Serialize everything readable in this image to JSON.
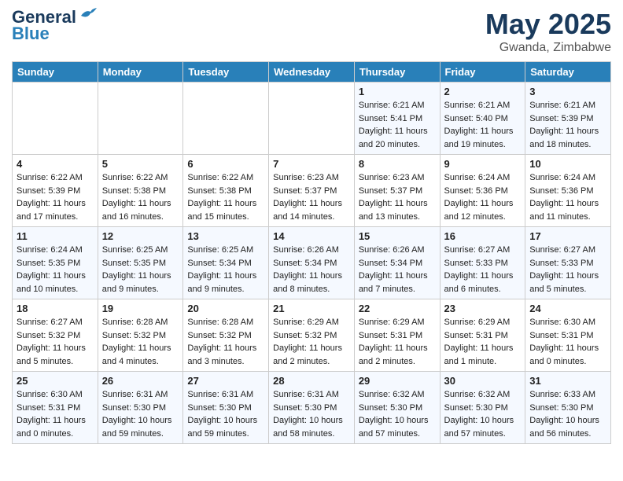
{
  "header": {
    "logo_line1": "General",
    "logo_line2": "Blue",
    "title": "May 2025",
    "subtitle": "Gwanda, Zimbabwe"
  },
  "days_of_week": [
    "Sunday",
    "Monday",
    "Tuesday",
    "Wednesday",
    "Thursday",
    "Friday",
    "Saturday"
  ],
  "weeks": [
    [
      {
        "day": "",
        "info": ""
      },
      {
        "day": "",
        "info": ""
      },
      {
        "day": "",
        "info": ""
      },
      {
        "day": "",
        "info": ""
      },
      {
        "day": "1",
        "info": "Sunrise: 6:21 AM\nSunset: 5:41 PM\nDaylight: 11 hours\nand 20 minutes."
      },
      {
        "day": "2",
        "info": "Sunrise: 6:21 AM\nSunset: 5:40 PM\nDaylight: 11 hours\nand 19 minutes."
      },
      {
        "day": "3",
        "info": "Sunrise: 6:21 AM\nSunset: 5:39 PM\nDaylight: 11 hours\nand 18 minutes."
      }
    ],
    [
      {
        "day": "4",
        "info": "Sunrise: 6:22 AM\nSunset: 5:39 PM\nDaylight: 11 hours\nand 17 minutes."
      },
      {
        "day": "5",
        "info": "Sunrise: 6:22 AM\nSunset: 5:38 PM\nDaylight: 11 hours\nand 16 minutes."
      },
      {
        "day": "6",
        "info": "Sunrise: 6:22 AM\nSunset: 5:38 PM\nDaylight: 11 hours\nand 15 minutes."
      },
      {
        "day": "7",
        "info": "Sunrise: 6:23 AM\nSunset: 5:37 PM\nDaylight: 11 hours\nand 14 minutes."
      },
      {
        "day": "8",
        "info": "Sunrise: 6:23 AM\nSunset: 5:37 PM\nDaylight: 11 hours\nand 13 minutes."
      },
      {
        "day": "9",
        "info": "Sunrise: 6:24 AM\nSunset: 5:36 PM\nDaylight: 11 hours\nand 12 minutes."
      },
      {
        "day": "10",
        "info": "Sunrise: 6:24 AM\nSunset: 5:36 PM\nDaylight: 11 hours\nand 11 minutes."
      }
    ],
    [
      {
        "day": "11",
        "info": "Sunrise: 6:24 AM\nSunset: 5:35 PM\nDaylight: 11 hours\nand 10 minutes."
      },
      {
        "day": "12",
        "info": "Sunrise: 6:25 AM\nSunset: 5:35 PM\nDaylight: 11 hours\nand 9 minutes."
      },
      {
        "day": "13",
        "info": "Sunrise: 6:25 AM\nSunset: 5:34 PM\nDaylight: 11 hours\nand 9 minutes."
      },
      {
        "day": "14",
        "info": "Sunrise: 6:26 AM\nSunset: 5:34 PM\nDaylight: 11 hours\nand 8 minutes."
      },
      {
        "day": "15",
        "info": "Sunrise: 6:26 AM\nSunset: 5:34 PM\nDaylight: 11 hours\nand 7 minutes."
      },
      {
        "day": "16",
        "info": "Sunrise: 6:27 AM\nSunset: 5:33 PM\nDaylight: 11 hours\nand 6 minutes."
      },
      {
        "day": "17",
        "info": "Sunrise: 6:27 AM\nSunset: 5:33 PM\nDaylight: 11 hours\nand 5 minutes."
      }
    ],
    [
      {
        "day": "18",
        "info": "Sunrise: 6:27 AM\nSunset: 5:32 PM\nDaylight: 11 hours\nand 5 minutes."
      },
      {
        "day": "19",
        "info": "Sunrise: 6:28 AM\nSunset: 5:32 PM\nDaylight: 11 hours\nand 4 minutes."
      },
      {
        "day": "20",
        "info": "Sunrise: 6:28 AM\nSunset: 5:32 PM\nDaylight: 11 hours\nand 3 minutes."
      },
      {
        "day": "21",
        "info": "Sunrise: 6:29 AM\nSunset: 5:32 PM\nDaylight: 11 hours\nand 2 minutes."
      },
      {
        "day": "22",
        "info": "Sunrise: 6:29 AM\nSunset: 5:31 PM\nDaylight: 11 hours\nand 2 minutes."
      },
      {
        "day": "23",
        "info": "Sunrise: 6:29 AM\nSunset: 5:31 PM\nDaylight: 11 hours\nand 1 minute."
      },
      {
        "day": "24",
        "info": "Sunrise: 6:30 AM\nSunset: 5:31 PM\nDaylight: 11 hours\nand 0 minutes."
      }
    ],
    [
      {
        "day": "25",
        "info": "Sunrise: 6:30 AM\nSunset: 5:31 PM\nDaylight: 11 hours\nand 0 minutes."
      },
      {
        "day": "26",
        "info": "Sunrise: 6:31 AM\nSunset: 5:30 PM\nDaylight: 10 hours\nand 59 minutes."
      },
      {
        "day": "27",
        "info": "Sunrise: 6:31 AM\nSunset: 5:30 PM\nDaylight: 10 hours\nand 59 minutes."
      },
      {
        "day": "28",
        "info": "Sunrise: 6:31 AM\nSunset: 5:30 PM\nDaylight: 10 hours\nand 58 minutes."
      },
      {
        "day": "29",
        "info": "Sunrise: 6:32 AM\nSunset: 5:30 PM\nDaylight: 10 hours\nand 57 minutes."
      },
      {
        "day": "30",
        "info": "Sunrise: 6:32 AM\nSunset: 5:30 PM\nDaylight: 10 hours\nand 57 minutes."
      },
      {
        "day": "31",
        "info": "Sunrise: 6:33 AM\nSunset: 5:30 PM\nDaylight: 10 hours\nand 56 minutes."
      }
    ]
  ]
}
